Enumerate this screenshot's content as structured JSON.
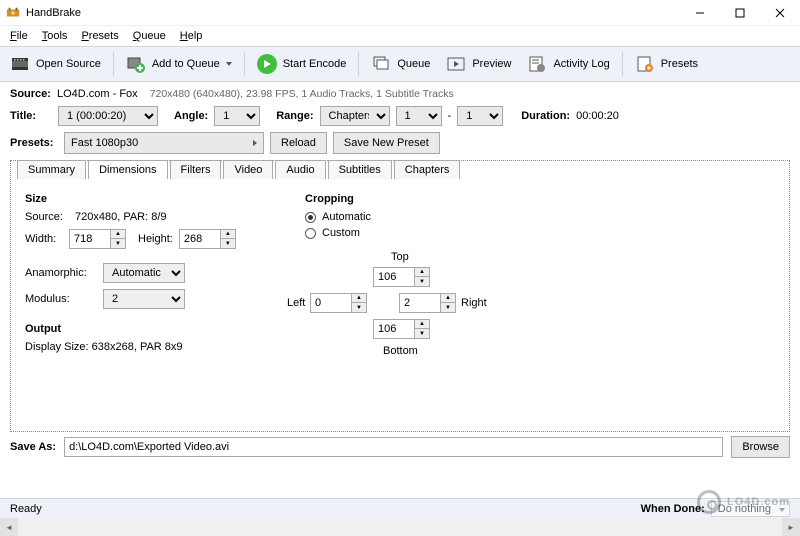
{
  "window": {
    "title": "HandBrake"
  },
  "menubar": {
    "file": "File",
    "tools": "Tools",
    "presets": "Presets",
    "queue": "Queue",
    "help": "Help"
  },
  "toolbar": {
    "open_source": "Open Source",
    "add_queue": "Add to Queue",
    "start_encode": "Start Encode",
    "queue": "Queue",
    "preview": "Preview",
    "activity_log": "Activity Log",
    "presets": "Presets"
  },
  "source": {
    "label": "Source:",
    "name": "LO4D.com - Fox",
    "info": "720x480 (640x480), 23.98 FPS, 1 Audio Tracks, 1 Subtitle Tracks"
  },
  "title_row": {
    "title_label": "Title:",
    "title_value": "1 (00:00:20)",
    "angle_label": "Angle:",
    "angle_value": "1",
    "range_label": "Range:",
    "range_type": "Chapters",
    "range_from": "1",
    "range_dash": "-",
    "range_to": "1",
    "duration_label": "Duration:",
    "duration_value": "00:00:20"
  },
  "presets_row": {
    "label": "Presets:",
    "value": "Fast 1080p30",
    "reload": "Reload",
    "save_new": "Save New Preset"
  },
  "tabs": [
    "Summary",
    "Dimensions",
    "Filters",
    "Video",
    "Audio",
    "Subtitles",
    "Chapters"
  ],
  "active_tab": "Dimensions",
  "dimensions": {
    "size_title": "Size",
    "source_label": "Source:",
    "source_value": "720x480, PAR: 8/9",
    "width_label": "Width:",
    "width_value": "718",
    "height_label": "Height:",
    "height_value": "268",
    "anamorphic_label": "Anamorphic:",
    "anamorphic_value": "Automatic",
    "modulus_label": "Modulus:",
    "modulus_value": "2",
    "output_title": "Output",
    "display_size": "Display Size: 638x268,  PAR 8x9"
  },
  "cropping": {
    "title": "Cropping",
    "automatic": "Automatic",
    "custom": "Custom",
    "top_label": "Top",
    "top_value": "106",
    "left_label": "Left",
    "left_value": "0",
    "right_label": "Right",
    "right_value": "2",
    "bottom_label": "Bottom",
    "bottom_value": "106"
  },
  "save_as": {
    "label": "Save As:",
    "value": "d:\\LO4D.com\\Exported Video.avi",
    "browse": "Browse"
  },
  "statusbar": {
    "ready": "Ready",
    "when_done_label": "When Done:",
    "when_done_value": "Do nothing"
  },
  "watermark": "LO4D.com"
}
